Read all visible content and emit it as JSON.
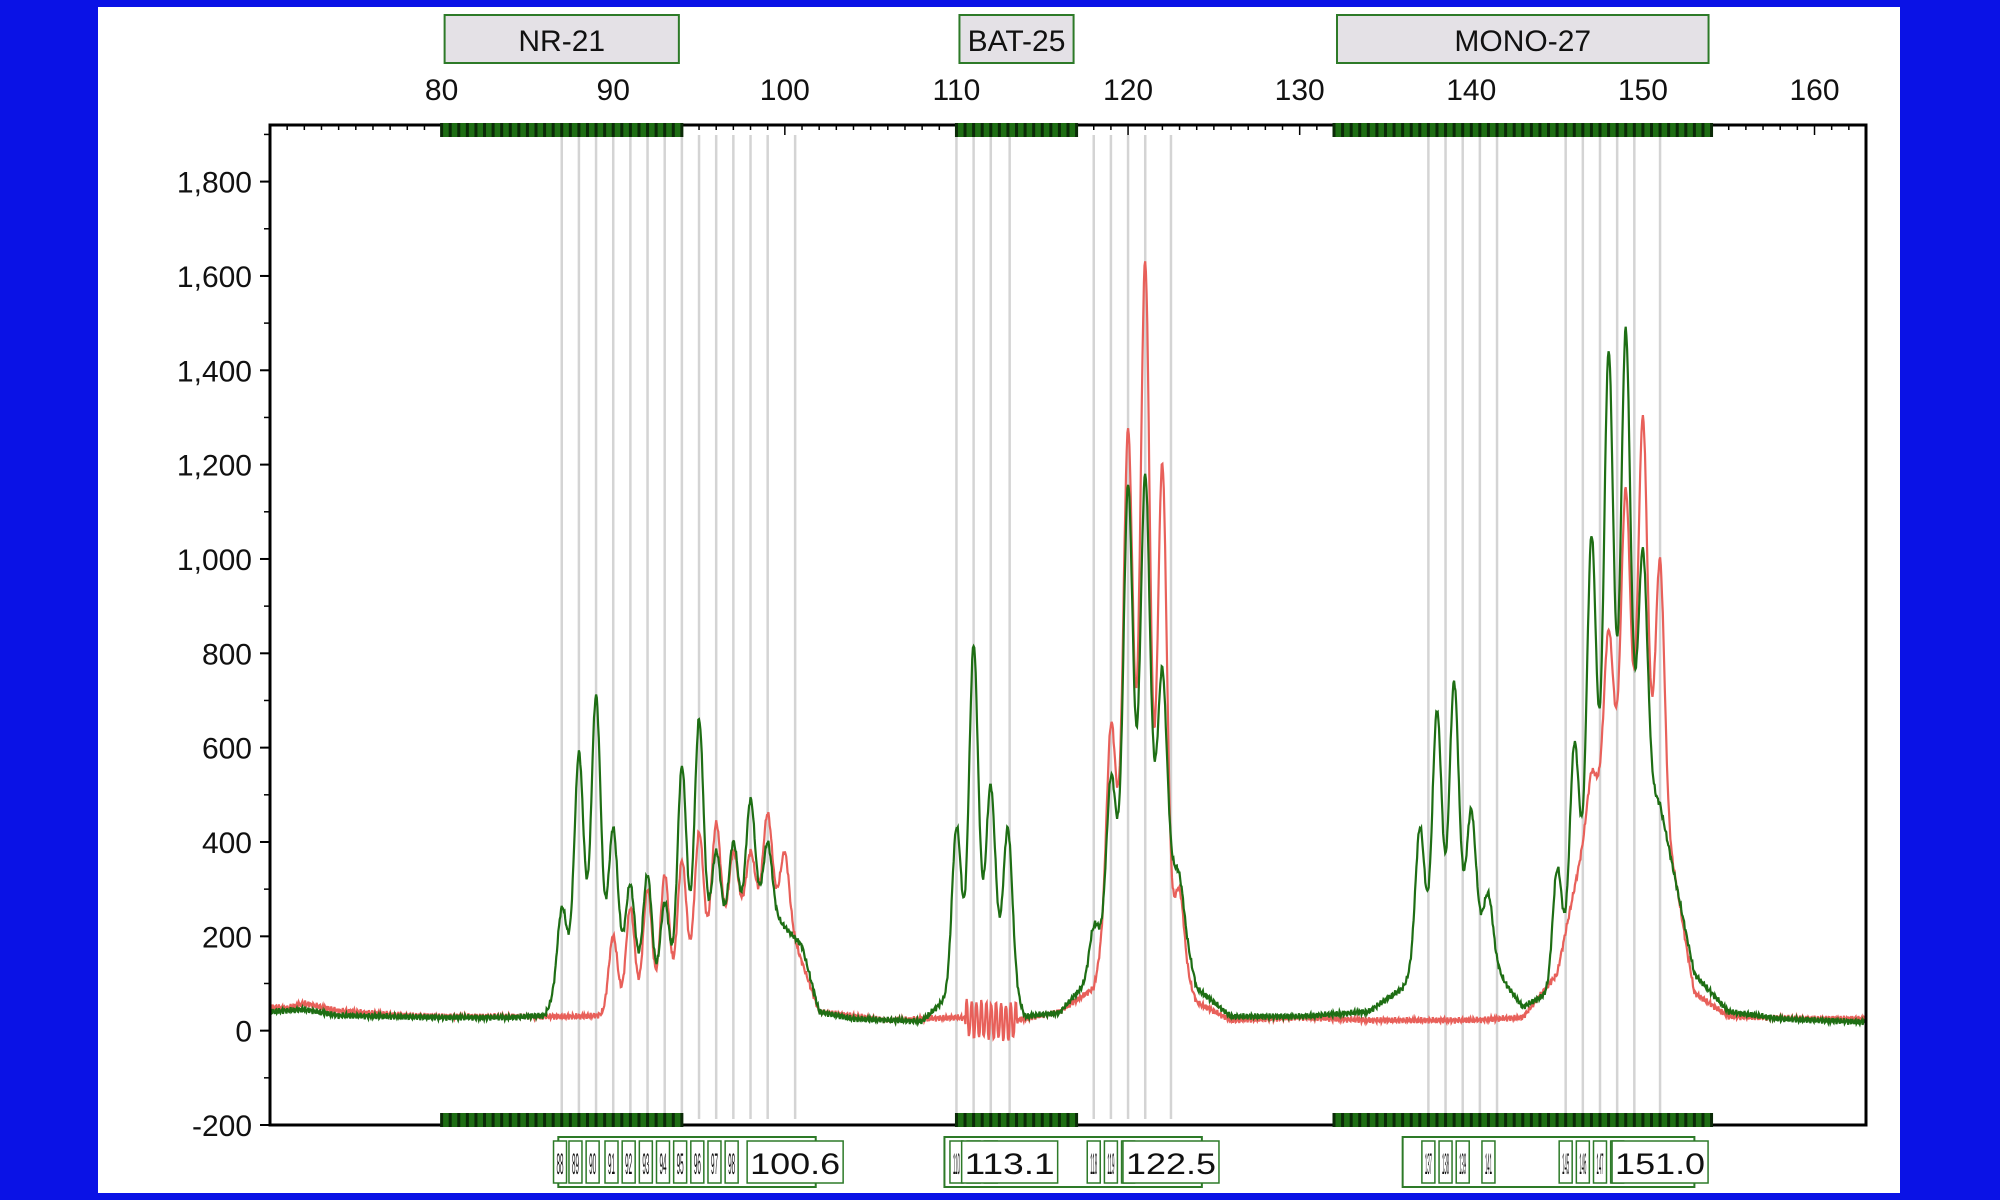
{
  "colors": {
    "background": "#0a12e6",
    "panel": "#ffffff",
    "sample_trace": "#1e6e14",
    "reference_trace": "#e8605a",
    "marker_box_fill": "#e4e1e6",
    "marker_box_border": "#2d7a28",
    "bin_line": "#d4d4d4",
    "tick_mark": "#1e6e14"
  },
  "chart_data": {
    "type": "line",
    "x_range": [
      70,
      163
    ],
    "y_range": [
      -200,
      1920
    ],
    "x_ticks": [
      80,
      90,
      100,
      110,
      120,
      130,
      140,
      150,
      160
    ],
    "y_ticks": [
      -200,
      0,
      200,
      400,
      600,
      800,
      1000,
      1200,
      1400,
      1600,
      1800
    ],
    "y_tick_labels": [
      "-200",
      "0",
      "200",
      "400",
      "600",
      "800",
      "1,000",
      "1,200",
      "1,400",
      "1,600",
      "1,800"
    ],
    "markers": [
      {
        "name": "NR-21",
        "start": 80,
        "end": 94
      },
      {
        "name": "BAT-25",
        "start": 110,
        "end": 117
      },
      {
        "name": "MONO-27",
        "start": 132,
        "end": 154
      }
    ],
    "marker_ranges": [
      [
        80,
        94
      ],
      [
        110,
        117
      ],
      [
        132,
        154
      ]
    ],
    "bin_lines": [
      87,
      88,
      89,
      90,
      91,
      92,
      93,
      94,
      95,
      96,
      97,
      98,
      99,
      100.6,
      110,
      111,
      112,
      113.1,
      118,
      119,
      120,
      121,
      122.5,
      137.5,
      138.5,
      139.5,
      140.5,
      141.5,
      145.5,
      146.5,
      147.5,
      148.5,
      149.5,
      151.0
    ],
    "allele_labels": [
      {
        "text": "88",
        "x": 86.9
      },
      {
        "text": "89",
        "x": 87.8
      },
      {
        "text": "90",
        "x": 88.8
      },
      {
        "text": "91",
        "x": 89.9
      },
      {
        "text": "92",
        "x": 90.9
      },
      {
        "text": "93",
        "x": 91.9
      },
      {
        "text": "94",
        "x": 92.9
      },
      {
        "text": "95",
        "x": 93.9
      },
      {
        "text": "96",
        "x": 94.9
      },
      {
        "text": "97",
        "x": 95.9
      },
      {
        "text": "98",
        "x": 96.9
      },
      {
        "text": "100.6",
        "x": 100.6
      },
      {
        "text": "110",
        "x": 110.0
      },
      {
        "text": "111",
        "x": 111.0
      },
      {
        "text": "112",
        "x": 112.0
      },
      {
        "text": "113.1",
        "x": 113.1
      },
      {
        "text": "118",
        "x": 118.0
      },
      {
        "text": "119",
        "x": 119.0
      },
      {
        "text": "120",
        "x": 120.0
      },
      {
        "text": "122.5",
        "x": 122.5
      },
      {
        "text": "137",
        "x": 137.5
      },
      {
        "text": "138",
        "x": 138.5
      },
      {
        "text": "139",
        "x": 139.5
      },
      {
        "text": "141",
        "x": 141.0
      },
      {
        "text": "145",
        "x": 145.5
      },
      {
        "text": "146",
        "x": 146.5
      },
      {
        "text": "147",
        "x": 147.5
      },
      {
        "text": "148",
        "x": 148.5
      },
      {
        "text": "151.0",
        "x": 151.0
      }
    ],
    "allele_groups": [
      {
        "start": 86.8,
        "end": 101.8
      },
      {
        "start": 109.3,
        "end": 124.3
      },
      {
        "start": 136.0,
        "end": 153.0
      }
    ],
    "series": [
      {
        "key": "reference",
        "baseline": [
          [
            70,
            50
          ],
          [
            71,
            48
          ],
          [
            72,
            58
          ],
          [
            74,
            42
          ],
          [
            78,
            32
          ],
          [
            80,
            30
          ],
          [
            88,
            30
          ],
          [
            92,
            38
          ],
          [
            93,
            55
          ],
          [
            94,
            80
          ],
          [
            96,
            180
          ],
          [
            98,
            260
          ],
          [
            100,
            250
          ],
          [
            102,
            40
          ],
          [
            106,
            22
          ],
          [
            110,
            28
          ],
          [
            113,
            18
          ],
          [
            116,
            40
          ],
          [
            118,
            90
          ],
          [
            120,
            450
          ],
          [
            124,
            60
          ],
          [
            126,
            22
          ],
          [
            130,
            28
          ],
          [
            134,
            22
          ],
          [
            140,
            22
          ],
          [
            143,
            28
          ],
          [
            145,
            120
          ],
          [
            147,
            480
          ],
          [
            149,
            580
          ],
          [
            151,
            500
          ],
          [
            153,
            80
          ],
          [
            155,
            30
          ],
          [
            160,
            25
          ],
          [
            163,
            25
          ]
        ],
        "peaks": [
          [
            90.0,
            200
          ],
          [
            91.0,
            260
          ],
          [
            92.0,
            300
          ],
          [
            93.0,
            330
          ],
          [
            94.0,
            360
          ],
          [
            95.0,
            420
          ],
          [
            96.0,
            440
          ],
          [
            97.0,
            380
          ],
          [
            98.0,
            380
          ],
          [
            99.0,
            460
          ],
          [
            100.0,
            380
          ],
          [
            119.0,
            650
          ],
          [
            120.0,
            1280
          ],
          [
            121.0,
            1630
          ],
          [
            122.0,
            1200
          ],
          [
            123.0,
            300
          ],
          [
            147.0,
            550
          ],
          [
            148.0,
            850
          ],
          [
            149.0,
            1150
          ],
          [
            150.0,
            1300
          ],
          [
            151.0,
            1000
          ],
          [
            152.0,
            300
          ]
        ],
        "jitter": [
          [
            110.5,
            113.5,
            40
          ]
        ]
      },
      {
        "key": "sample",
        "baseline": [
          [
            70,
            40
          ],
          [
            72,
            45
          ],
          [
            74,
            32
          ],
          [
            80,
            28
          ],
          [
            84,
            28
          ],
          [
            86,
            32
          ],
          [
            87,
            100
          ],
          [
            88,
            180
          ],
          [
            90,
            160
          ],
          [
            92,
            80
          ],
          [
            93,
            70
          ],
          [
            95,
            180
          ],
          [
            97,
            220
          ],
          [
            99,
            260
          ],
          [
            101,
            180
          ],
          [
            102,
            40
          ],
          [
            104,
            25
          ],
          [
            108,
            20
          ],
          [
            110,
            90
          ],
          [
            111,
            200
          ],
          [
            113,
            120
          ],
          [
            114,
            30
          ],
          [
            116,
            38
          ],
          [
            118,
            120
          ],
          [
            120,
            400
          ],
          [
            122,
            420
          ],
          [
            124,
            90
          ],
          [
            126,
            30
          ],
          [
            130,
            30
          ],
          [
            134,
            40
          ],
          [
            136,
            90
          ],
          [
            138,
            220
          ],
          [
            140,
            240
          ],
          [
            142,
            100
          ],
          [
            143,
            50
          ],
          [
            145,
            90
          ],
          [
            147,
            380
          ],
          [
            149,
            600
          ],
          [
            151,
            480
          ],
          [
            153,
            120
          ],
          [
            155,
            40
          ],
          [
            158,
            25
          ],
          [
            163,
            18
          ]
        ],
        "peaks": [
          [
            87.0,
            260
          ],
          [
            88.0,
            590
          ],
          [
            89.0,
            710
          ],
          [
            90.0,
            430
          ],
          [
            91.0,
            310
          ],
          [
            92.0,
            330
          ],
          [
            93.0,
            270
          ],
          [
            94.0,
            560
          ],
          [
            95.0,
            660
          ],
          [
            96.0,
            380
          ],
          [
            97.0,
            400
          ],
          [
            98.0,
            490
          ],
          [
            99.0,
            400
          ],
          [
            110.0,
            430
          ],
          [
            111.0,
            820
          ],
          [
            112.0,
            520
          ],
          [
            113.0,
            430
          ],
          [
            118.0,
            220
          ],
          [
            119.0,
            540
          ],
          [
            120.0,
            1160
          ],
          [
            121.0,
            1180
          ],
          [
            122.0,
            770
          ],
          [
            123.0,
            330
          ],
          [
            137.0,
            430
          ],
          [
            138.0,
            680
          ],
          [
            139.0,
            740
          ],
          [
            140.0,
            470
          ],
          [
            141.0,
            290
          ],
          [
            145.0,
            340
          ],
          [
            146.0,
            610
          ],
          [
            147.0,
            1050
          ],
          [
            148.0,
            1440
          ],
          [
            149.0,
            1490
          ],
          [
            150.0,
            1020
          ],
          [
            151.0,
            380
          ]
        ]
      }
    ]
  }
}
